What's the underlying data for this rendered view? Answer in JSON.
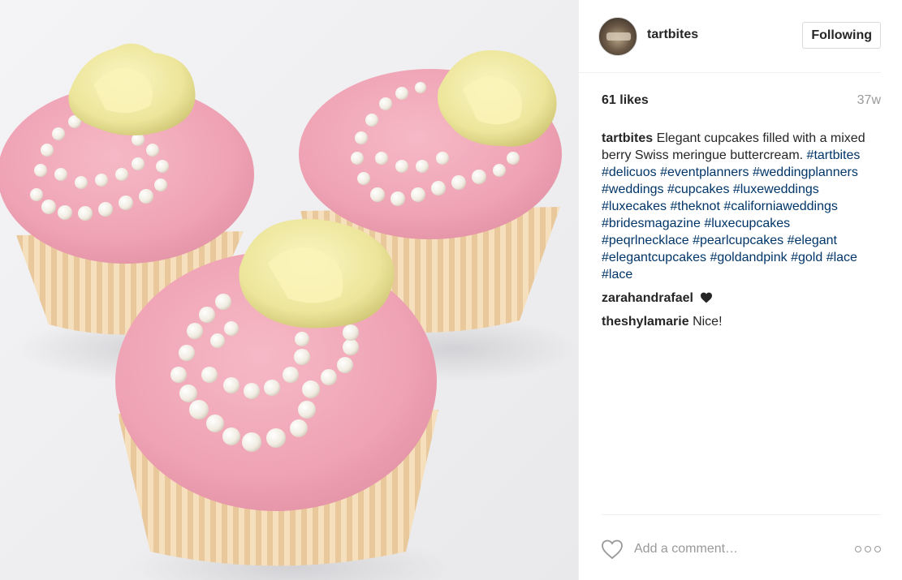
{
  "post": {
    "photo_alt": "cupcakes-photo"
  },
  "header": {
    "username": "tartbites",
    "follow_label": "Following"
  },
  "stats": {
    "likes": "61 likes",
    "time_ago": "37w"
  },
  "caption": {
    "author": "tartbites",
    "text": "Elegant cupcakes filled with a mixed berry Swiss meringue buttercream.",
    "hashtags": [
      "#tartbites",
      "#delicuos",
      "#eventplanners",
      "#weddingplanners",
      "#weddings",
      "#cupcakes",
      "#luxeweddings",
      "#luxecakes",
      "#theknot",
      "#californiaweddings",
      "#bridesmagazine",
      "#luxecupcakes",
      "#peqrlnecklace",
      "#pearlcupcakes",
      "#elegant",
      "#elegantcupcakes",
      "#goldandpink",
      "#gold",
      "#lace",
      "#lace"
    ]
  },
  "comments": [
    {
      "author": "zarahandrafael",
      "text": "",
      "emoji": "black-heart-icon"
    },
    {
      "author": "theshylamarie",
      "text": "Nice!"
    }
  ],
  "footer": {
    "comment_placeholder": "Add a comment…",
    "like_icon": "heart-outline-icon",
    "more_icon": "more-options-icon"
  },
  "colors": {
    "hashtag": "#003569",
    "muted": "#999999",
    "text": "#262626",
    "border": "#efefef"
  }
}
